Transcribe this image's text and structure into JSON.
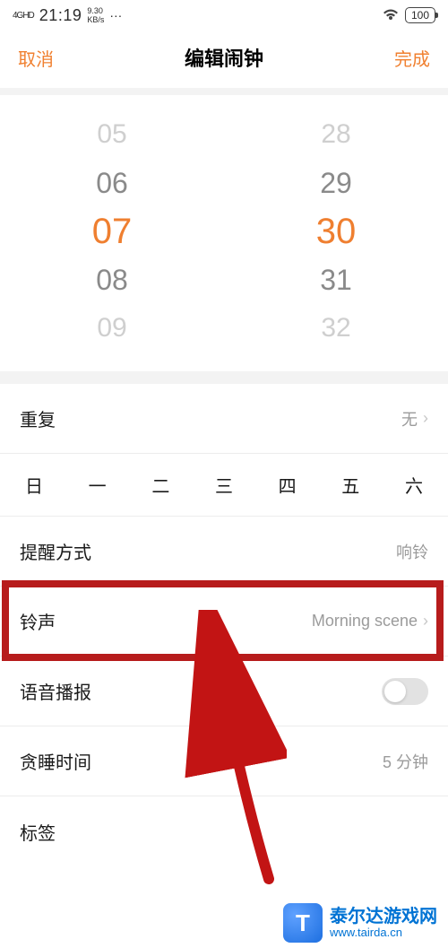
{
  "status": {
    "signal": "4GHD",
    "time": "21:19",
    "net_speed": "9.30",
    "net_unit": "KB/s",
    "dots": "···",
    "battery": "100"
  },
  "header": {
    "cancel": "取消",
    "title": "编辑闹钟",
    "done": "完成"
  },
  "picker": {
    "hours": [
      "05",
      "06",
      "07",
      "08",
      "09"
    ],
    "minutes": [
      "28",
      "29",
      "30",
      "31",
      "32"
    ]
  },
  "rows": {
    "repeat": {
      "label": "重复",
      "value": "无"
    },
    "weekdays": [
      "日",
      "一",
      "二",
      "三",
      "四",
      "五",
      "六"
    ],
    "remind": {
      "label": "提醒方式",
      "value": "响铃"
    },
    "ringtone": {
      "label": "铃声",
      "value": "Morning scene"
    },
    "voice": {
      "label": "语音播报"
    },
    "snooze": {
      "label": "贪睡时间",
      "value": "5 分钟"
    },
    "tag": {
      "label": "标签"
    }
  },
  "watermark": {
    "logo_letter": "T",
    "title": "泰尔达游戏网",
    "url": "www.tairda.cn"
  }
}
